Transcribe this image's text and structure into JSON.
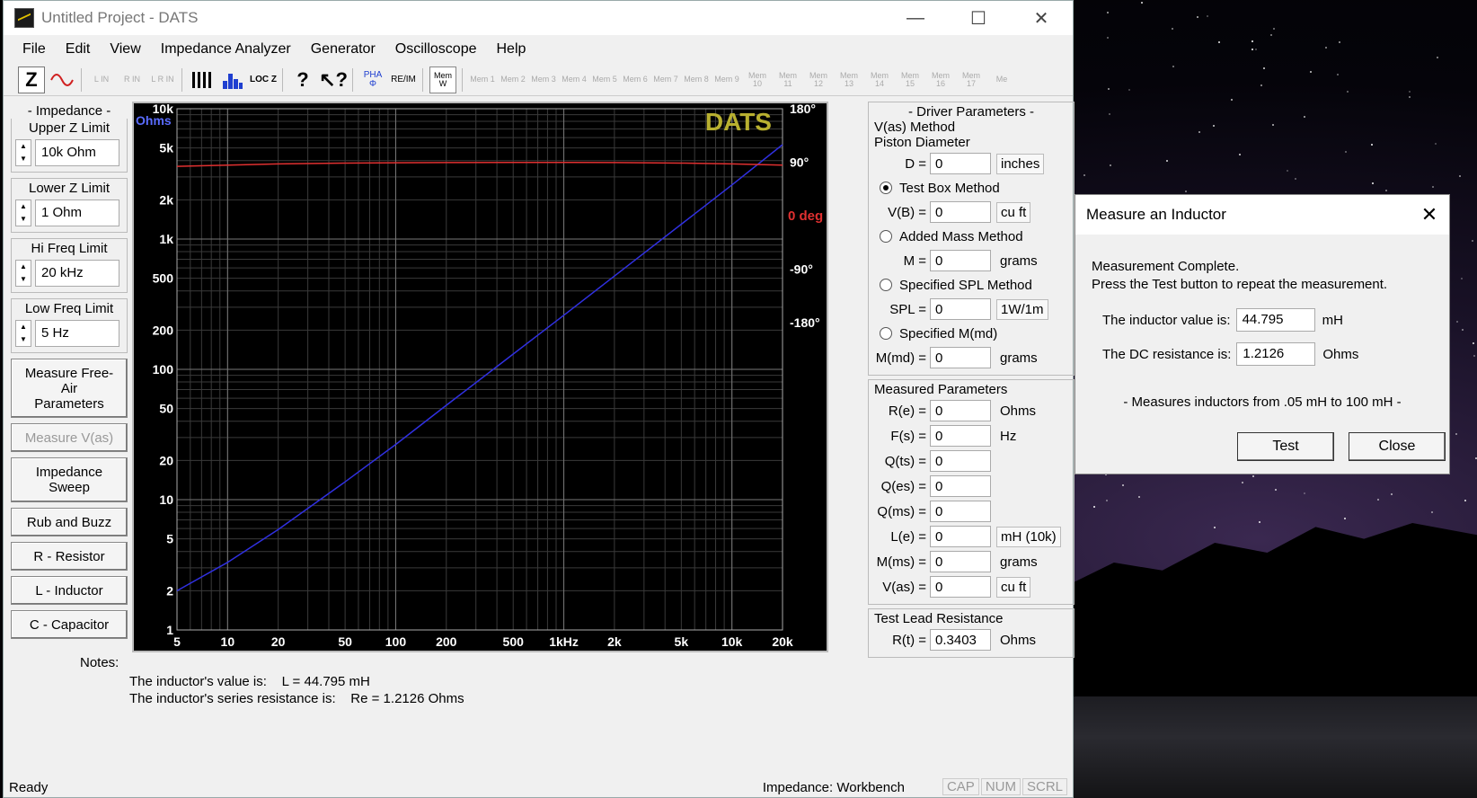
{
  "window": {
    "title": "Untitled Project - DATS"
  },
  "menu": [
    "File",
    "Edit",
    "View",
    "Impedance Analyzer",
    "Generator",
    "Oscilloscope",
    "Help"
  ],
  "toolbar": {
    "z_label": "Z",
    "input_labels": [
      "L IN",
      "R IN",
      "L R IN"
    ],
    "loc_label": "LOC Z",
    "pha_label": "PHA Φ",
    "reim_label": "RE/IM",
    "mem_label": "Mem W",
    "mem_slots": [
      "Mem 1",
      "Mem 2",
      "Mem 3",
      "Mem 4",
      "Mem 5",
      "Mem 6",
      "Mem 7",
      "Mem 8",
      "Mem 9",
      "Mem 10",
      "Mem 11",
      "Mem 12",
      "Mem 13",
      "Mem 14",
      "Mem 15",
      "Mem 16",
      "Mem 17",
      "Me"
    ]
  },
  "left": {
    "impedance_header": "- Impedance -",
    "upper_z": {
      "label": "Upper Z Limit",
      "value": "10k Ohm"
    },
    "lower_z": {
      "label": "Lower Z Limit",
      "value": "1 Ohm"
    },
    "hi_freq": {
      "label": "Hi Freq Limit",
      "value": "20 kHz"
    },
    "low_freq": {
      "label": "Low Freq Limit",
      "value": "5 Hz"
    },
    "buttons": {
      "measure_free_air": "Measure Free-Air Parameters",
      "measure_vas": "Measure V(as)",
      "impedance_sweep": "Impedance Sweep",
      "rub_buzz": "Rub and Buzz",
      "resistor": "R - Resistor",
      "inductor": "L - Inductor",
      "capacitor": "C - Capacitor"
    }
  },
  "graph": {
    "brand": "DATS",
    "unit_label": "Ohms",
    "phase_unit": "0 deg"
  },
  "chart_data": {
    "type": "line",
    "x_scale": "log",
    "y_scale": "log",
    "xlim": [
      5,
      20000
    ],
    "ylim": [
      1,
      10000
    ],
    "y2lim": [
      -180,
      180
    ],
    "x_ticks": [
      "5",
      "10",
      "20",
      "50",
      "100",
      "200",
      "500",
      "1kHz",
      "2k",
      "5k",
      "10k",
      "20k"
    ],
    "x_tick_values": [
      5,
      10,
      20,
      50,
      100,
      200,
      500,
      1000,
      2000,
      5000,
      10000,
      20000
    ],
    "y_ticks": [
      "10k",
      "5k",
      "2k",
      "1k",
      "500",
      "200",
      "100",
      "50",
      "20",
      "10",
      "5",
      "2",
      "1"
    ],
    "y_tick_values": [
      10000,
      5000,
      2000,
      1000,
      500,
      200,
      100,
      50,
      20,
      10,
      5,
      2,
      1
    ],
    "y2_ticks": [
      "180°",
      "90°",
      "-90°",
      "-180°"
    ],
    "y2_tick_values": [
      180,
      90,
      -90,
      -180
    ],
    "grid": true,
    "series": [
      {
        "color": "#3030e0",
        "axis": "left",
        "x": [
          5,
          10,
          20,
          50,
          100,
          200,
          500,
          1000,
          2000,
          5000,
          10000,
          20000
        ],
        "y": [
          2.0,
          3.3,
          5.9,
          13.7,
          26.5,
          53,
          131,
          260,
          520,
          1300,
          2600,
          5300
        ]
      },
      {
        "color": "#e03030",
        "axis": "right",
        "x": [
          5,
          10,
          20,
          50,
          100,
          200,
          500,
          1000,
          2000,
          5000,
          10000,
          20000
        ],
        "y": [
          83,
          85,
          87,
          88.5,
          89,
          89.3,
          89.5,
          89.5,
          89.3,
          88.5,
          87,
          85
        ]
      }
    ]
  },
  "right": {
    "driver_header": "- Driver Parameters -",
    "vas_method": "V(as) Method",
    "piston": {
      "label": "Piston Diameter",
      "d_label": "D =",
      "d_value": "0",
      "d_unit": "inches"
    },
    "test_box": {
      "label": "Test Box Method",
      "vb_label": "V(B) =",
      "vb_value": "0",
      "vb_unit": "cu ft"
    },
    "added_mass": {
      "label": "Added Mass Method",
      "m_label": "M =",
      "m_value": "0",
      "m_unit": "grams"
    },
    "spl": {
      "label": "Specified SPL Method",
      "spl_label": "SPL =",
      "spl_value": "0",
      "spl_unit": "1W/1m"
    },
    "mmd": {
      "label": "Specified M(md)",
      "mmd_label": "M(md) =",
      "mmd_value": "0",
      "mmd_unit": "grams"
    },
    "measured_header": "Measured Parameters",
    "measured": [
      {
        "label": "R(e) =",
        "value": "0",
        "unit": "Ohms",
        "boxed": false
      },
      {
        "label": "F(s) =",
        "value": "0",
        "unit": "Hz",
        "boxed": false
      },
      {
        "label": "Q(ts) =",
        "value": "0",
        "unit": "",
        "boxed": false
      },
      {
        "label": "Q(es) =",
        "value": "0",
        "unit": "",
        "boxed": false
      },
      {
        "label": "Q(ms) =",
        "value": "0",
        "unit": "",
        "boxed": false
      },
      {
        "label": "L(e) =",
        "value": "0",
        "unit": "mH (10k)",
        "boxed": true
      },
      {
        "label": "M(ms) =",
        "value": "0",
        "unit": "grams",
        "boxed": false
      },
      {
        "label": "V(as) =",
        "value": "0",
        "unit": "cu ft",
        "boxed": true
      }
    ],
    "lead_header": "Test Lead Resistance",
    "lead": {
      "label": "R(t) =",
      "value": "0.3403",
      "unit": "Ohms"
    }
  },
  "notes": {
    "label": "Notes:",
    "line1": "The inductor's value is:    L = 44.795 mH",
    "line2": "The inductor's series resistance is:    Re = 1.2126 Ohms"
  },
  "status": {
    "left": "Ready",
    "mode": "Impedance: Workbench",
    "cap": "CAP",
    "num": "NUM",
    "scrl": "SCRL"
  },
  "dialog": {
    "title": "Measure an Inductor",
    "msg1": "Measurement Complete.",
    "msg2": "Press the Test button to repeat the measurement.",
    "inductor_label": "The inductor value is:",
    "inductor_value": "44.795",
    "inductor_unit": "mH",
    "dc_label": "The DC resistance is:",
    "dc_value": "1.2126",
    "dc_unit": "Ohms",
    "note": "- Measures inductors from .05 mH to 100 mH -",
    "test_label": "Test",
    "close_label": "Close"
  }
}
